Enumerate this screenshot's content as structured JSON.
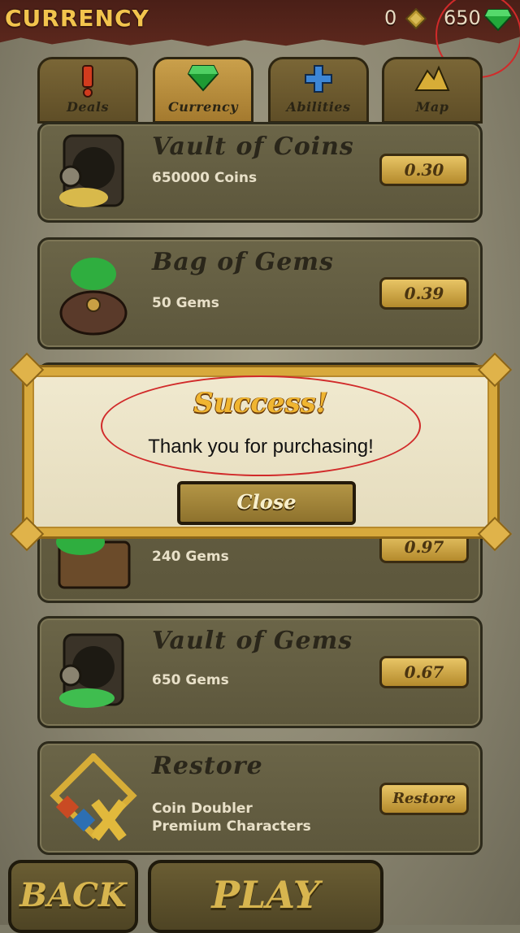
{
  "header": {
    "title": "CURRENCY",
    "coins": "0",
    "gems": "650"
  },
  "tabs": [
    {
      "label": "Deals",
      "icon": "exclamation-icon"
    },
    {
      "label": "Currency",
      "icon": "gem-icon"
    },
    {
      "label": "Abilities",
      "icon": "plus-icon"
    },
    {
      "label": "Map",
      "icon": "mountain-icon"
    }
  ],
  "items": [
    {
      "title": "Vault of Coins",
      "subtitle": "650000 Coins",
      "price": "0.30",
      "icon": "coin-vault-icon"
    },
    {
      "title": "Bag of Gems",
      "subtitle": "50 Gems",
      "price": "0.39",
      "icon": "gem-bag-icon"
    },
    {
      "title": "",
      "subtitle": "240 Gems",
      "price": "0.97",
      "icon": "gem-chest-icon"
    },
    {
      "title": "Vault of Gems",
      "subtitle": "650 Gems",
      "price": "0.67",
      "icon": "gem-vault-icon"
    },
    {
      "title": "Restore",
      "subtitle": "Coin Doubler",
      "subtitle2": "Premium Characters",
      "price": "Restore",
      "icon": "restore-icon"
    }
  ],
  "modal": {
    "title": "Success!",
    "message": "Thank you for purchasing!",
    "close_label": "Close"
  },
  "footer": {
    "back_label": "BACK",
    "play_label": "PLAY"
  },
  "colors": {
    "accent_gold": "#d8a93c",
    "header_bg": "#4a1f17",
    "annotation_red": "#d12a2a"
  }
}
